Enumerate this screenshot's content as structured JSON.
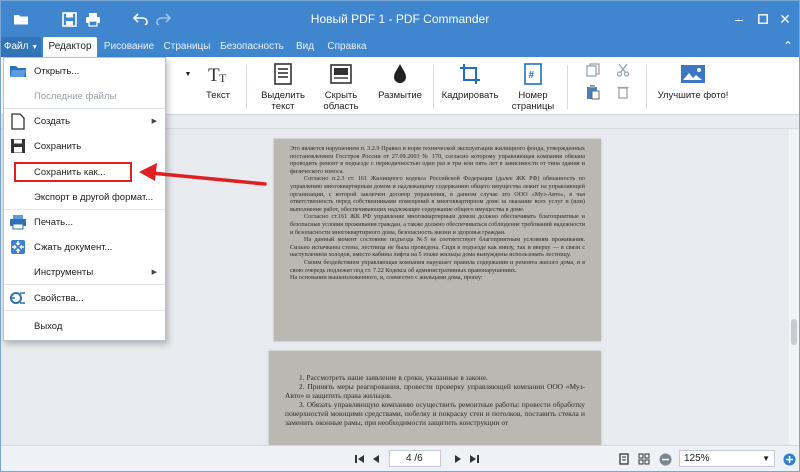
{
  "window": {
    "title": "Новый PDF 1 - PDF Commander"
  },
  "tabs": {
    "file": "Файл",
    "editor": "Редактор",
    "drawing": "Рисование",
    "pages": "Страницы",
    "security": "Безопасность",
    "view": "Вид",
    "help": "Справка"
  },
  "ribbon": {
    "text": "Текст",
    "highlight_text": "Выделить текст",
    "hide_area": "Скрыть область",
    "blur": "Размытие",
    "crop": "Кадрировать",
    "page_number": "Номер страницы",
    "improve_photo": "Улучшите фото!"
  },
  "file_menu": {
    "open": "Открыть...",
    "recent": "Последние файлы",
    "create": "Создать",
    "save": "Сохранить",
    "save_as": "Сохранить как...",
    "export": "Экспорт в другой формат...",
    "print": "Печать...",
    "compress": "Сжать документ...",
    "tools": "Инструменты",
    "properties": "Свойства...",
    "exit": "Выход"
  },
  "document": {
    "page1": [
      "Это является нарушением п. 3.2.9 Правил и норм технической эксплуатации жилищного фонда, утвержденных постановлением Госстроя России от 27.09.2003 № 170, согласно которому управляющая компания обязана проводить ремонт в подъезде с периодичностью один раз в три или пять лет в зависимости от типа здания и физического износа.",
      "Согласно п.2.3 ст. 161 Жилищного кодекса Российской Федерации (далее ЖК РФ) обязанность по управлению многоквартирным домом и надлежащему содержанию общего имущества лежит на управляющей организации, с которой заключен договор управления, в данном случае это ООО «Муз-Авто», в чья ответственность перед собственниками помещений в многоквартирном доме за оказание всех услуг и (или) выполнение работ, обеспечивающих надлежащее содержание общего имущества в доме.",
      "Согласно ст.161 ЖК РФ управление многоквартирным домом должно обеспечивать благоприятные и безопасные условия проживания граждан, а также должно обеспечиваться соблюдение требований надежности и безопасности многоквартирного дома, безопасность жизни и здоровья граждан.",
      "На данный момент состояние подъезда №5 не соответствует благоприятным условиям проживания. Сильно испачканы стены, лестница не была проведена. Сидя в подъезде как внизу, так и вверху — в связи с наступлением холодов, вместо кабины лифта на 5 этаже жильцы дома вынуждены использовать лестницу.",
      "Своим бездействием управляющая компания нарушает правила содержания и ремонта жилого дома, и в свою очередь подлежит под ст. 7.22 Кодекса об административных правонарушениях.",
      "На основании вышеизложенного, и, совместно с жильцами дома, прошу:"
    ],
    "page2": [
      "1. Рассмотреть наше заявление в сроки, указанные в законе.",
      "2. Принять меры реагирования, провести проверку управляющей компании ООО «Муз-Авто» и защитить права жильцов.",
      "3. Обязать управляющую компанию осуществить ремонтные работы: провести обработку поверхностей моющими средствами, побелку и покраску стен и потолков, поставить стекла и заменить оконные рамы, при необходимости защитить конструкции от"
    ]
  },
  "status": {
    "page_current": "4",
    "page_total": "/6",
    "zoom": "125%"
  },
  "colors": {
    "titlebar": "#3f86cf",
    "highlight_box": "#e02020",
    "arrow": "#e02020"
  }
}
